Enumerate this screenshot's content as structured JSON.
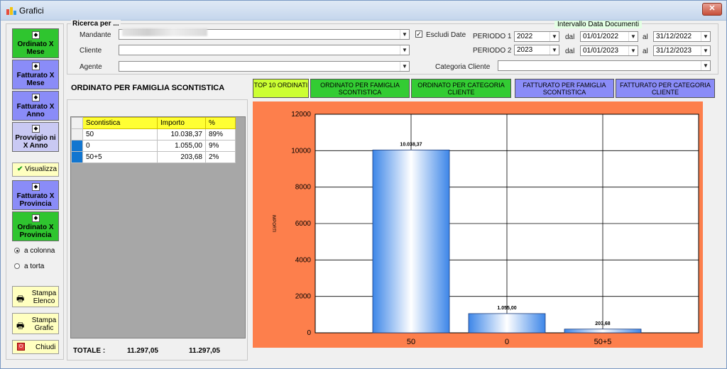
{
  "window": {
    "title": "Grafici",
    "close_label": "✕"
  },
  "left_buttons": [
    {
      "label": "Ordinato X Mese",
      "color": "green"
    },
    {
      "label": "Fatturato X Mese",
      "color": "purple"
    },
    {
      "label": "Fatturato X Anno",
      "color": "purple"
    },
    {
      "label": "Provvigio ni X Anno",
      "color": "lilac"
    }
  ],
  "visualizza_label": "Visualizza",
  "left_buttons2": [
    {
      "label": "Fatturato X Provincia",
      "color": "purple"
    },
    {
      "label": "Ordinato X Provincia",
      "color": "green"
    }
  ],
  "radio": {
    "colonna": "a colonna",
    "torta": "a torta"
  },
  "actions": {
    "stampa_elenco": "Stampa Elenco",
    "stampa_grafic": "Stampa Grafic",
    "chiudi": "Chiudi"
  },
  "search": {
    "group_title": "Ricerca per ...",
    "mandante_label": "Mandante",
    "cliente_label": "Cliente",
    "agente_label": "Agente",
    "escludi_date": "Escludi Date",
    "escludi_checked": "✓",
    "intervallo_label": "Intervallo Data Documenti",
    "periodo1_label": "PERIODO 1",
    "periodo2_label": "PERIODO 2",
    "periodo1_year": "2022",
    "periodo2_year": "2023",
    "dal_label": "dal",
    "al_label": "al",
    "p1_dal": "01/01/2022",
    "p1_al": "31/12/2022",
    "p2_dal": "01/01/2023",
    "p2_al": "31/12/2023",
    "categoria_label": "Categoria Cliente"
  },
  "section_title": "ORDINATO PER FAMIGLIA SCONTISTICA",
  "table": {
    "headers": [
      "Scontistica",
      "Importo",
      "%"
    ],
    "rows": [
      {
        "scontistica": "50",
        "importo": "10.038,37",
        "pct": "89%"
      },
      {
        "scontistica": "0",
        "importo": "1.055,00",
        "pct": "9%"
      },
      {
        "scontistica": "50+5",
        "importo": "203,68",
        "pct": "2%"
      }
    ]
  },
  "totale": {
    "label": "TOTALE :",
    "value1": "11.297,05",
    "value2": "11.297,05"
  },
  "tabs": [
    {
      "label": "TOP 10 ORDINATI",
      "color": "#ccff33"
    },
    {
      "label": "ORDINATO PER FAMIGLIA SCONTISTICA",
      "color": "#33cc33"
    },
    {
      "label": "ORDINATO PER CATEGORIA CLIENTE",
      "color": "#33cc33"
    },
    {
      "label": "FATTURATO PER FAMIGLIA SCONTISTICA",
      "color": "#8a8cf8"
    },
    {
      "label": "FATTURATO PER CATEGORIA CLIENTE",
      "color": "#8a8cf8"
    }
  ],
  "chart_data": {
    "type": "bar",
    "categories": [
      "50",
      "0",
      "50+5"
    ],
    "values": [
      10038.37,
      1055.0,
      203.68
    ],
    "data_labels": [
      "10.038,37",
      "1.055,00",
      "203,68"
    ],
    "ylabel": "IMPORTI",
    "ylim": [
      0,
      12000
    ],
    "yticks": [
      0,
      2000,
      4000,
      6000,
      8000,
      10000,
      12000
    ],
    "grid": true,
    "background": "#fd7f4c",
    "bar_color": "#3d86e8"
  }
}
